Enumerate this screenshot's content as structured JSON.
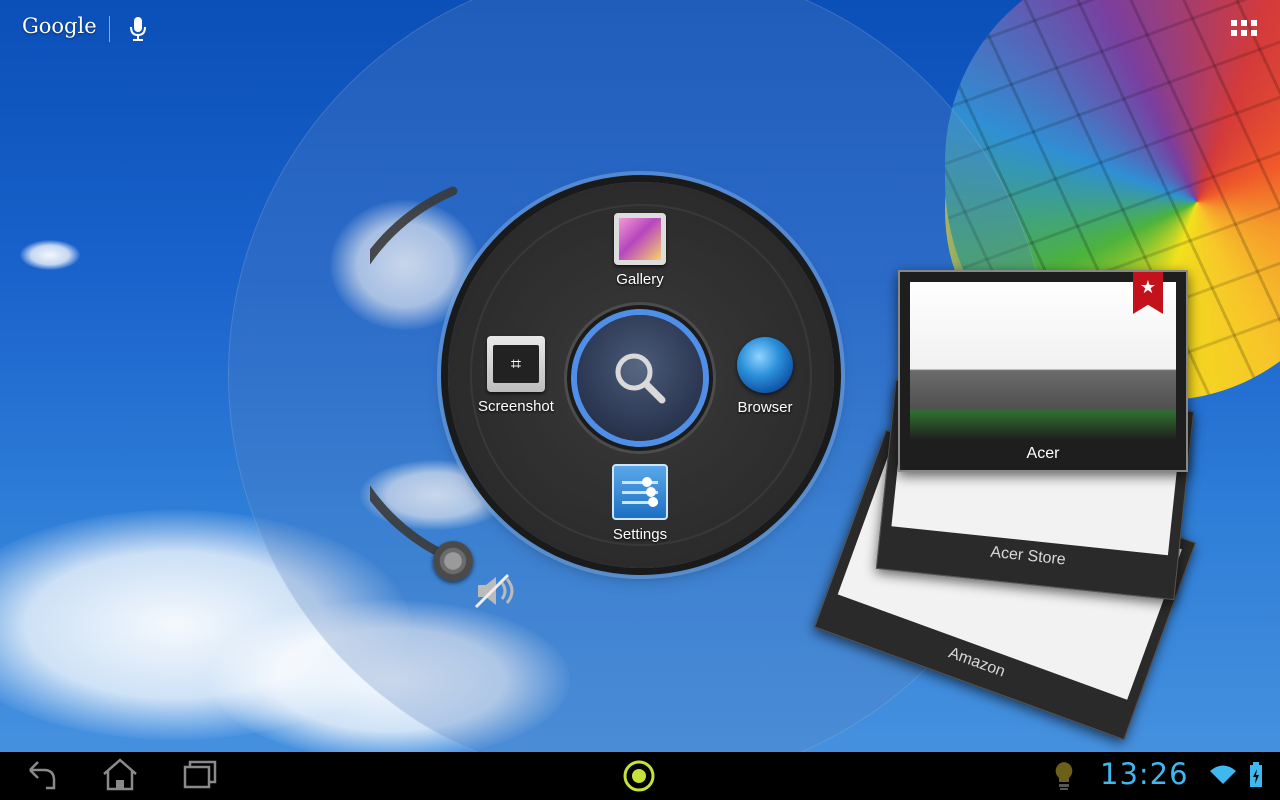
{
  "search_bar": {
    "google_label": "Google"
  },
  "menu": {
    "items": [
      {
        "id": "gallery",
        "label": "Gallery"
      },
      {
        "id": "screenshot",
        "label": "Screenshot"
      },
      {
        "id": "browser",
        "label": "Browser"
      },
      {
        "id": "settings",
        "label": "Settings"
      }
    ]
  },
  "recent_cards": [
    {
      "label": "Acer"
    },
    {
      "label": "Acer Store"
    },
    {
      "label": "Amazon"
    }
  ],
  "system_bar": {
    "clock": "13:26"
  },
  "colors": {
    "accent_blue": "#4f8fe8",
    "clock_blue": "#3fb8f0",
    "home_ring": "#c6e23a"
  },
  "icons": [
    "mic-icon",
    "apps-grid-icon",
    "search-icon",
    "mute-icon",
    "back-icon",
    "home-icon",
    "recent-apps-icon",
    "lightbulb-icon",
    "wifi-icon",
    "battery-icon",
    "bookmark-star-icon"
  ]
}
